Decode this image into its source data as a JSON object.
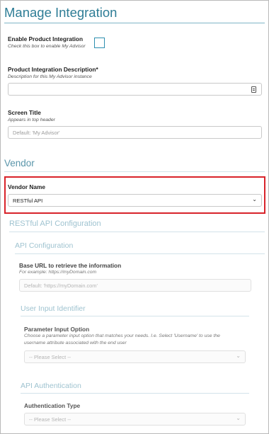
{
  "header": {
    "title": "Manage Integration"
  },
  "enable_integration": {
    "label": "Enable Product Integration",
    "hint": "Check this box to enable My Advisor"
  },
  "description": {
    "label": "Product Integration Description*",
    "hint": "Description for this My Advisor instance",
    "value": ""
  },
  "screen_title": {
    "label": "Screen Title",
    "hint": "Appears in top header",
    "placeholder": "Default: 'My Advisor'"
  },
  "vendor_section": {
    "title": "Vendor"
  },
  "vendor_name": {
    "label": "Vendor Name",
    "selected": "RESTful API"
  },
  "restful_config": {
    "title": "RESTful API Configuration"
  },
  "api_config": {
    "title": "API Configuration",
    "base_url_label": "Base URL to retrieve the information",
    "base_url_hint": "For example: https://myDomain.com",
    "base_url_placeholder": "Default: 'https://myDomain.com'"
  },
  "user_input": {
    "title": "User Input Identifier",
    "param_label": "Parameter Input Option",
    "param_hint_line1": "Choose a parameter input option that matches your needs. I.e. Select 'Username' to use the",
    "param_hint_line2": "username attribute associated with the end user",
    "param_selected": "-- Please Select --"
  },
  "api_auth": {
    "title": "API Authentication",
    "auth_label": "Authentication Type",
    "auth_selected": "-- Please Select --"
  },
  "colors": {
    "accent": "#2e8fb0",
    "heading": "#2e7d96",
    "highlight": "#d8232a"
  }
}
